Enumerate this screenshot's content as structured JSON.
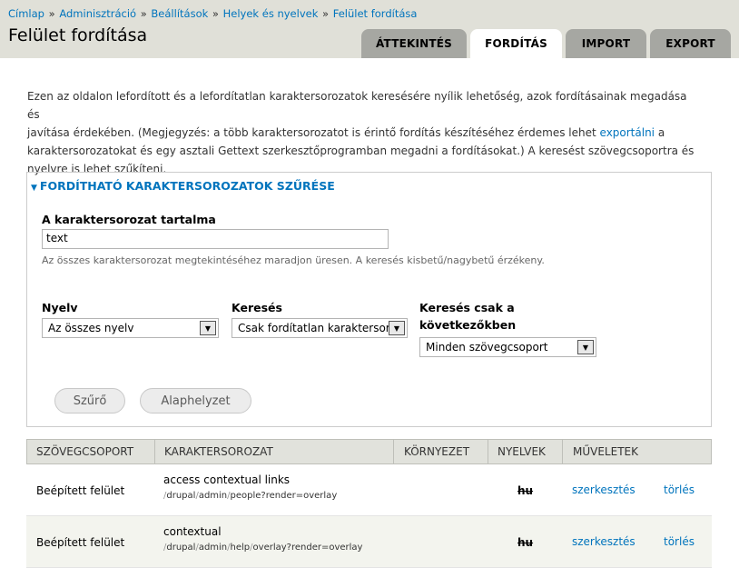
{
  "breadcrumb": [
    "Címlap",
    "Adminisztráció",
    "Beállítások",
    "Helyek és nyelvek",
    "Felület fordítása"
  ],
  "breadcrumb_sep": "»",
  "page_title": "Felület fordítása",
  "tabs": [
    {
      "label": "ÁTTEKINTÉS",
      "active": false
    },
    {
      "label": "FORDÍTÁS",
      "active": true
    },
    {
      "label": "IMPORT",
      "active": false
    },
    {
      "label": "EXPORT",
      "active": false
    }
  ],
  "intro": {
    "line1": "Ezen az oldalon lefordított és a lefordítatlan karaktersorozatok keresésére nyílik lehetőség, azok fordításainak megadása és",
    "line2_before": "javítása érdekében. (Megjegyzés: a több karaktersorozatot is érintő fordítás készítéséhez érdemes lehet ",
    "link": "exportálni",
    "line2_after": " a",
    "line3": "karaktersorozatokat és egy asztali Gettext szerkesztőprogramban megadni a fordításokat.) A keresést szövegcsoportra és",
    "line4": "nyelvre is lehet szűkíteni."
  },
  "filter": {
    "legend": "FORDÍTHATÓ KARAKTERSOROZATOK SZŰRÉSE",
    "string_label": "A karaktersorozat tartalma",
    "string_value": "text",
    "string_desc": "Az összes karaktersorozat megtekintéséhez maradjon üresen. A keresés kisbetű/nagybetű érzékeny.",
    "language_label": "Nyelv",
    "language_value": "Az összes nyelv",
    "search_label": "Keresés",
    "search_value": "Csak fordítatlan karaktersor",
    "group_label_1": "Keresés csak a",
    "group_label_2": "következőkben",
    "group_value": "Minden szövegcsoport",
    "filter_button": "Szűrő",
    "reset_button": "Alaphelyzet"
  },
  "table": {
    "headers": [
      "SZÖVEGCSOPORT",
      "KARAKTERSOROZAT",
      "KÖRNYEZET",
      "NYELVEK",
      "MŰVELETEK"
    ],
    "rows": [
      {
        "group": "Beépített felület",
        "source": "access contextual links",
        "path": [
          "drupal",
          "admin",
          "people?render=overlay"
        ],
        "lang": "hu",
        "edit": "szerkesztés",
        "delete": "törlés"
      },
      {
        "group": "Beépített felület",
        "source": "contextual",
        "path": [
          "drupal",
          "admin",
          "help",
          "overlay?render=overlay"
        ],
        "lang": "hu",
        "edit": "szerkesztés",
        "delete": "törlés"
      }
    ]
  }
}
